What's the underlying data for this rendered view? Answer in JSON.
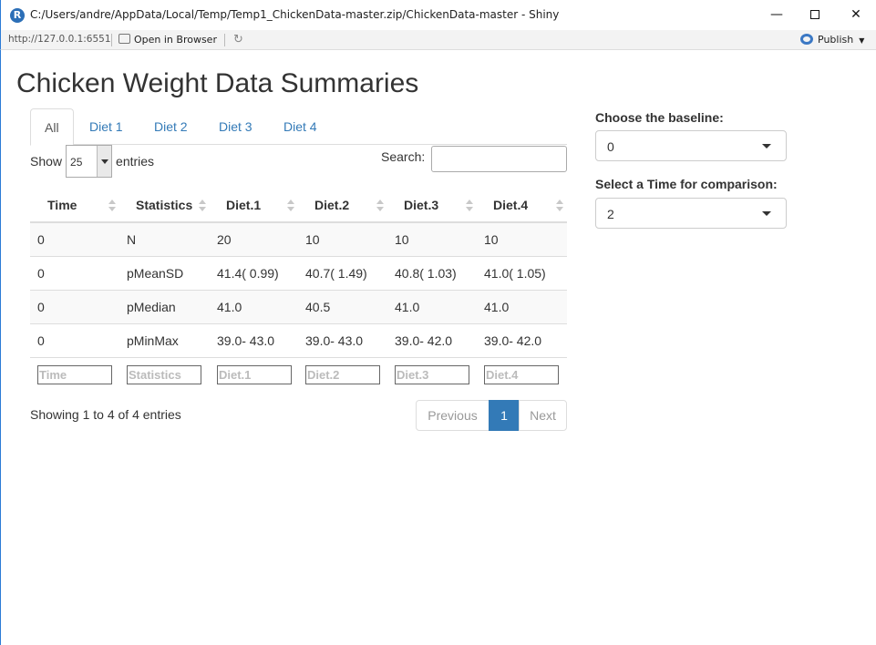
{
  "window": {
    "title": "C:/Users/andre/AppData/Local/Temp/Temp1_ChickenData-master.zip/ChickenData-master - Shiny",
    "app_icon_letter": "R",
    "minimize": "—",
    "close": "✕"
  },
  "toolbar": {
    "url": "http://127.0.0.1:6551",
    "open_in_browser": "Open in Browser",
    "publish": "Publish"
  },
  "page": {
    "title": "Chicken Weight Data Summaries"
  },
  "tabs": [
    {
      "label": "All",
      "active": true
    },
    {
      "label": "Diet 1"
    },
    {
      "label": "Diet 2"
    },
    {
      "label": "Diet 3"
    },
    {
      "label": "Diet 4"
    }
  ],
  "table_controls": {
    "show_label": "Show",
    "entries_value": "25",
    "entries_label": "entries",
    "search_label": "Search:",
    "search_value": ""
  },
  "table": {
    "columns": [
      "Time",
      "Statistics",
      "Diet.1",
      "Diet.2",
      "Diet.3",
      "Diet.4"
    ],
    "rows": [
      [
        "0",
        "N",
        "20",
        "10",
        "10",
        "10"
      ],
      [
        "0",
        "pMeanSD",
        "41.4( 0.99)",
        "40.7( 1.49)",
        "40.8( 1.03)",
        "41.0( 1.05)"
      ],
      [
        "0",
        "pMedian",
        "41.0",
        "40.5",
        "41.0",
        "41.0"
      ],
      [
        "0",
        "pMinMax",
        "39.0- 43.0",
        "39.0- 43.0",
        "39.0- 42.0",
        "39.0- 42.0"
      ]
    ],
    "filter_placeholders": [
      "Time",
      "Statistics",
      "Diet.1",
      "Diet.2",
      "Diet.3",
      "Diet.4"
    ]
  },
  "pagination": {
    "info": "Showing 1 to 4 of 4 entries",
    "previous": "Previous",
    "current": "1",
    "next": "Next"
  },
  "sidebar": {
    "baseline_label": "Choose the baseline:",
    "baseline_value": "0",
    "time_label": "Select a Time for comparison:",
    "time_value": "2"
  },
  "colors": {
    "link": "#337ab7",
    "active_page": "#337ab7",
    "window_border": "#2b7bd6"
  }
}
